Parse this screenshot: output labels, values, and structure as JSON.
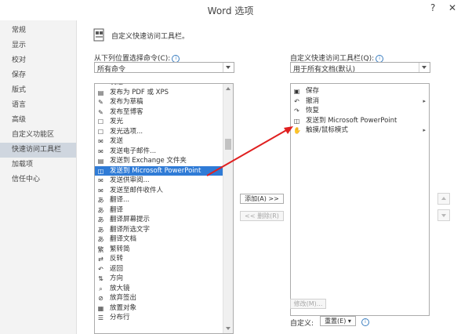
{
  "window": {
    "title": "Word 选项",
    "help": "?",
    "close": "✕"
  },
  "nav": [
    {
      "label": "常规"
    },
    {
      "label": "显示"
    },
    {
      "label": "校对"
    },
    {
      "label": "保存"
    },
    {
      "label": "版式"
    },
    {
      "label": "语言"
    },
    {
      "label": "高级"
    },
    {
      "label": "自定义功能区"
    },
    {
      "label": "快速访问工具栏",
      "selected": true
    },
    {
      "label": "加载项"
    },
    {
      "label": "信任中心"
    }
  ],
  "header": {
    "text": "自定义快速访问工具栏。"
  },
  "left": {
    "label": "从下列位置选择命令(C):",
    "combo_value": "所有命令",
    "items": [
      {
        "label": "发送",
        "icon": "send"
      },
      {
        "label": "发布为 PDF 或 XPS",
        "icon": "pdf"
      },
      {
        "label": "发布为草稿",
        "icon": "draft"
      },
      {
        "label": "发布至博客",
        "icon": "blog"
      },
      {
        "label": "发光",
        "icon": "glow",
        "sub": "▸"
      },
      {
        "label": "发光选项...",
        "icon": "glow-options"
      },
      {
        "label": "发送",
        "icon": "send",
        "sub": "▸"
      },
      {
        "label": "发送电子邮件...",
        "icon": "email"
      },
      {
        "label": "发送到 Exchange 文件夹",
        "icon": "exchange"
      },
      {
        "label": "发送到 Microsoft PowerPoint",
        "icon": "powerpoint",
        "selected": true
      },
      {
        "label": "发送供审阅...",
        "icon": "review"
      },
      {
        "label": "发送至邮件收件人",
        "icon": "recipient"
      },
      {
        "label": "翻译...",
        "icon": "translate"
      },
      {
        "label": "翻译",
        "icon": "translate",
        "sub": "▸"
      },
      {
        "label": "翻译屏幕提示",
        "icon": "translate-tip"
      },
      {
        "label": "翻译所选文字",
        "icon": "translate-text"
      },
      {
        "label": "翻译文档",
        "icon": "translate-doc"
      },
      {
        "label": "繁转简",
        "icon": "convert"
      },
      {
        "label": "反转",
        "icon": "reverse"
      },
      {
        "label": "返回",
        "icon": "back"
      },
      {
        "label": "方向",
        "icon": "direction",
        "sub": "▸"
      },
      {
        "label": "放大镜",
        "icon": "magnifier"
      },
      {
        "label": "放弃签出",
        "icon": "discard-checkout"
      },
      {
        "label": "放置对象",
        "icon": "place-object",
        "sub": "▸"
      },
      {
        "label": "分布行",
        "icon": "distribute-rows"
      }
    ]
  },
  "right": {
    "label": "自定义快速访问工具栏(Q):",
    "combo_value": "用于所有文档(默认)",
    "items": [
      {
        "label": "保存",
        "icon": "save"
      },
      {
        "label": "撤消",
        "icon": "undo",
        "sub": "▸"
      },
      {
        "label": "恢复",
        "icon": "redo"
      },
      {
        "label": "发送到 Microsoft PowerPoint",
        "icon": "powerpoint"
      },
      {
        "label": "触摸/鼠标模式",
        "icon": "touch",
        "sub": "▸"
      }
    ]
  },
  "buttons": {
    "add": "添加(A) >>",
    "remove": "<< 删除(R)",
    "modify": "修改(M)...",
    "reset": "重置(E) ▾"
  },
  "customize_label": "自定义:",
  "colors": {
    "selected": "#2f7bd6",
    "arrow": "#e02020"
  }
}
